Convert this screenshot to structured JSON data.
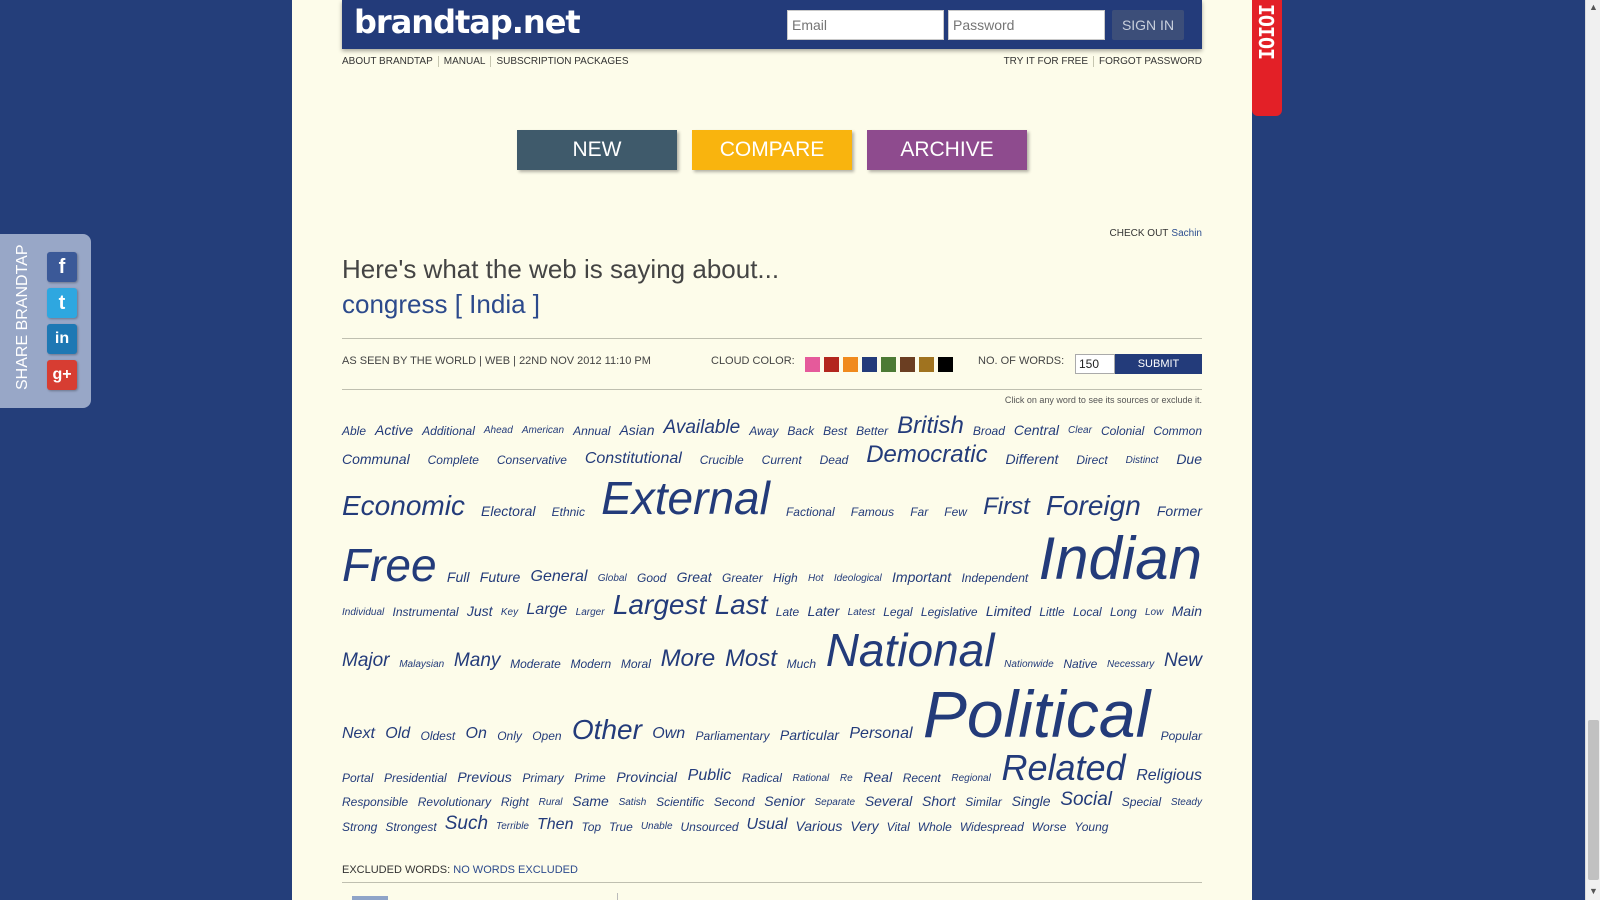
{
  "header": {
    "logo": "brandtap.net",
    "email_placeholder": "Email",
    "password_placeholder": "Password",
    "signin_label": "SIGN IN"
  },
  "nav_left": [
    "ABOUT BRANDTAP",
    "MANUAL",
    "SUBSCRIPTION PACKAGES"
  ],
  "nav_right": [
    "TRY IT FOR FREE",
    "FORGOT PASSWORD"
  ],
  "actions": {
    "new": "NEW",
    "compare": "COMPARE",
    "archive": "ARCHIVE"
  },
  "checkout": {
    "label": "CHECK OUT",
    "name": "Sachin"
  },
  "headline": "Here's what the web is saying about...",
  "subject": "congress [ India ]",
  "meta": {
    "text": "AS SEEN BY THE WORLD  |  WEB  |  22ND NOV 2012 11:10 PM",
    "cloud_color_label": "CLOUD COLOR:",
    "cloud_colors": [
      "#e55a9b",
      "#b3261e",
      "#f08a1d",
      "#233b7a",
      "#4c7a35",
      "#6b3e22",
      "#a0731f",
      "#000000"
    ],
    "words_label": "NO. OF WORDS:",
    "words_value": "150",
    "submit_label": "SUBMIT"
  },
  "hint": "Click on any word to see its sources or exclude it.",
  "words": [
    {
      "text": "Able",
      "size": 1
    },
    {
      "text": "Active",
      "size": 2
    },
    {
      "text": "Additional",
      "size": 1
    },
    {
      "text": "Ahead",
      "size": 0
    },
    {
      "text": "American",
      "size": 0
    },
    {
      "text": "Annual",
      "size": 1
    },
    {
      "text": "Asian",
      "size": 2
    },
    {
      "text": "Available",
      "size": 4
    },
    {
      "text": "Away",
      "size": 1
    },
    {
      "text": "Back",
      "size": 1
    },
    {
      "text": "Best",
      "size": 1
    },
    {
      "text": "Better",
      "size": 1
    },
    {
      "text": "British",
      "size": 5
    },
    {
      "text": "Broad",
      "size": 1
    },
    {
      "text": "Central",
      "size": 2
    },
    {
      "text": "Clear",
      "size": 0
    },
    {
      "text": "Colonial",
      "size": 1
    },
    {
      "text": "Common",
      "size": 1
    },
    {
      "text": "Communal",
      "size": 2
    },
    {
      "text": "Complete",
      "size": 1
    },
    {
      "text": "Conservative",
      "size": 1
    },
    {
      "text": "Constitutional",
      "size": 3
    },
    {
      "text": "Crucible",
      "size": 1
    },
    {
      "text": "Current",
      "size": 1
    },
    {
      "text": "Dead",
      "size": 1
    },
    {
      "text": "Democratic",
      "size": 5
    },
    {
      "text": "Different",
      "size": 2
    },
    {
      "text": "Direct",
      "size": 1
    },
    {
      "text": "Distinct",
      "size": 0
    },
    {
      "text": "Due",
      "size": 2
    },
    {
      "text": "Economic",
      "size": 6
    },
    {
      "text": "Electoral",
      "size": 2
    },
    {
      "text": "Ethnic",
      "size": 1
    },
    {
      "text": "External",
      "size": 8
    },
    {
      "text": "Factional",
      "size": 1
    },
    {
      "text": "Famous",
      "size": 1
    },
    {
      "text": "Far",
      "size": 1
    },
    {
      "text": "Few",
      "size": 1
    },
    {
      "text": "First",
      "size": 5
    },
    {
      "text": "Foreign",
      "size": 6
    },
    {
      "text": "Former",
      "size": 2
    },
    {
      "text": "Free",
      "size": 8
    },
    {
      "text": "Full",
      "size": 2
    },
    {
      "text": "Future",
      "size": 2
    },
    {
      "text": "General",
      "size": 3
    },
    {
      "text": "Global",
      "size": 0
    },
    {
      "text": "Good",
      "size": 1
    },
    {
      "text": "Great",
      "size": 2
    },
    {
      "text": "Greater",
      "size": 1
    },
    {
      "text": "High",
      "size": 1
    },
    {
      "text": "Hot",
      "size": 0
    },
    {
      "text": "Ideological",
      "size": 0
    },
    {
      "text": "Important",
      "size": 2
    },
    {
      "text": "Independent",
      "size": 1
    },
    {
      "text": "Indian",
      "size": 9
    },
    {
      "text": "Individual",
      "size": 0
    },
    {
      "text": "Instrumental",
      "size": 1
    },
    {
      "text": "Just",
      "size": 2
    },
    {
      "text": "Key",
      "size": 0
    },
    {
      "text": "Large",
      "size": 3
    },
    {
      "text": "Larger",
      "size": 0
    },
    {
      "text": "Largest",
      "size": 6
    },
    {
      "text": "Last",
      "size": 6
    },
    {
      "text": "Late",
      "size": 1
    },
    {
      "text": "Later",
      "size": 2
    },
    {
      "text": "Latest",
      "size": 0
    },
    {
      "text": "Legal",
      "size": 1
    },
    {
      "text": "Legislative",
      "size": 1
    },
    {
      "text": "Limited",
      "size": 2
    },
    {
      "text": "Little",
      "size": 1
    },
    {
      "text": "Local",
      "size": 1
    },
    {
      "text": "Long",
      "size": 1
    },
    {
      "text": "Low",
      "size": 0
    },
    {
      "text": "Main",
      "size": 2
    },
    {
      "text": "Major",
      "size": 4
    },
    {
      "text": "Malaysian",
      "size": 0
    },
    {
      "text": "Many",
      "size": 4
    },
    {
      "text": "Moderate",
      "size": 1
    },
    {
      "text": "Modern",
      "size": 1
    },
    {
      "text": "Moral",
      "size": 1
    },
    {
      "text": "More",
      "size": 5
    },
    {
      "text": "Most",
      "size": 5
    },
    {
      "text": "Much",
      "size": 1
    },
    {
      "text": "National",
      "size": 8
    },
    {
      "text": "Nationwide",
      "size": 0
    },
    {
      "text": "Native",
      "size": 1
    },
    {
      "text": "Necessary",
      "size": 0
    },
    {
      "text": "New",
      "size": 4
    },
    {
      "text": "Next",
      "size": 3
    },
    {
      "text": "Old",
      "size": 3
    },
    {
      "text": "Oldest",
      "size": 1
    },
    {
      "text": "On",
      "size": 3
    },
    {
      "text": "Only",
      "size": 1
    },
    {
      "text": "Open",
      "size": 1
    },
    {
      "text": "Other",
      "size": 6
    },
    {
      "text": "Own",
      "size": 3
    },
    {
      "text": "Parliamentary",
      "size": 1
    },
    {
      "text": "Particular",
      "size": 2
    },
    {
      "text": "Personal",
      "size": 3
    },
    {
      "text": "Political",
      "size": 10
    },
    {
      "text": "Popular",
      "size": 1
    },
    {
      "text": "Portal",
      "size": 1
    },
    {
      "text": "Presidential",
      "size": 1
    },
    {
      "text": "Previous",
      "size": 2
    },
    {
      "text": "Primary",
      "size": 1
    },
    {
      "text": "Prime",
      "size": 1
    },
    {
      "text": "Provincial",
      "size": 2
    },
    {
      "text": "Public",
      "size": 3
    },
    {
      "text": "Radical",
      "size": 1
    },
    {
      "text": "Rational",
      "size": 0
    },
    {
      "text": "Re",
      "size": 0
    },
    {
      "text": "Real",
      "size": 2
    },
    {
      "text": "Recent",
      "size": 1
    },
    {
      "text": "Regional",
      "size": 0
    },
    {
      "text": "Related",
      "size": 7
    },
    {
      "text": "Religious",
      "size": 3
    },
    {
      "text": "Responsible",
      "size": 1
    },
    {
      "text": "Revolutionary",
      "size": 1
    },
    {
      "text": "Right",
      "size": 1
    },
    {
      "text": "Rural",
      "size": 0
    },
    {
      "text": "Same",
      "size": 2
    },
    {
      "text": "Satish",
      "size": 0
    },
    {
      "text": "Scientific",
      "size": 1
    },
    {
      "text": "Second",
      "size": 1
    },
    {
      "text": "Senior",
      "size": 2
    },
    {
      "text": "Separate",
      "size": 0
    },
    {
      "text": "Several",
      "size": 2
    },
    {
      "text": "Short",
      "size": 2
    },
    {
      "text": "Similar",
      "size": 1
    },
    {
      "text": "Single",
      "size": 2
    },
    {
      "text": "Social",
      "size": 4
    },
    {
      "text": "Special",
      "size": 1
    },
    {
      "text": "Steady",
      "size": 0
    },
    {
      "text": "Strong",
      "size": 1
    },
    {
      "text": "Strongest",
      "size": 1
    },
    {
      "text": "Such",
      "size": 4
    },
    {
      "text": "Terrible",
      "size": 0
    },
    {
      "text": "Then",
      "size": 3
    },
    {
      "text": "Top",
      "size": 1
    },
    {
      "text": "True",
      "size": 1
    },
    {
      "text": "Unable",
      "size": 0
    },
    {
      "text": "Unsourced",
      "size": 1
    },
    {
      "text": "Usual",
      "size": 3
    },
    {
      "text": "Various",
      "size": 2
    },
    {
      "text": "Very",
      "size": 2
    },
    {
      "text": "Vital",
      "size": 1
    },
    {
      "text": "Whole",
      "size": 1
    },
    {
      "text": "Widespread",
      "size": 1
    },
    {
      "text": "Worse",
      "size": 1
    },
    {
      "text": "Young",
      "size": 1
    }
  ],
  "excluded": {
    "label": "EXCLUDED WORDS:",
    "value": "NO WORDS EXCLUDED"
  },
  "share": {
    "label": "SHARE BRANDTAP",
    "facebook": "f",
    "twitter": "t",
    "linkedin": "in",
    "googleplus": "g+"
  },
  "ribbon": "IOIOI"
}
